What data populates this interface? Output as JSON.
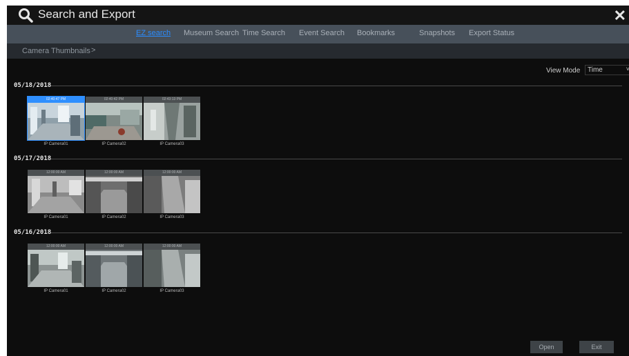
{
  "window": {
    "title": "Search and Export"
  },
  "tabs": [
    {
      "label": "EZ search",
      "active": true
    },
    {
      "label": "Museum Search",
      "active": false
    },
    {
      "label": "Time Search",
      "active": false
    },
    {
      "label": "Event Search",
      "active": false
    },
    {
      "label": "Bookmarks",
      "active": false
    },
    {
      "label": "Snapshots",
      "active": false
    },
    {
      "label": "Export Status",
      "active": false
    }
  ],
  "breadcrumb": {
    "label": "Camera Thumbnails",
    "arrow": ">"
  },
  "view_mode": {
    "label": "View Mode",
    "value": "Time"
  },
  "groups": [
    {
      "date": "05/18/2018",
      "items": [
        {
          "time": "02:40:47 PM",
          "camera": "IP Camera01",
          "selected": true
        },
        {
          "time": "02:40:42 PM",
          "camera": "IP Camera02",
          "selected": false
        },
        {
          "time": "02:43:13 PM",
          "camera": "IP Camera03",
          "selected": false
        }
      ]
    },
    {
      "date": "05/17/2018",
      "items": [
        {
          "time": "12:00:00 AM",
          "camera": "IP Camera01",
          "selected": false
        },
        {
          "time": "12:00:00 AM",
          "camera": "IP Camera02",
          "selected": false
        },
        {
          "time": "12:00:00 AM",
          "camera": "IP Camera03",
          "selected": false
        }
      ]
    },
    {
      "date": "05/16/2018",
      "items": [
        {
          "time": "12:00:00 AM",
          "camera": "IP Camera01",
          "selected": false
        },
        {
          "time": "12:00:00 AM",
          "camera": "IP Camera02",
          "selected": false
        },
        {
          "time": "12:00:00 AM",
          "camera": "IP Camera03",
          "selected": false
        }
      ]
    }
  ],
  "buttons": {
    "open": "Open",
    "exit": "Exit"
  },
  "colors": {
    "accent": "#2f8fff",
    "tab_bar": "#47505a",
    "background": "#0d0d0d"
  }
}
